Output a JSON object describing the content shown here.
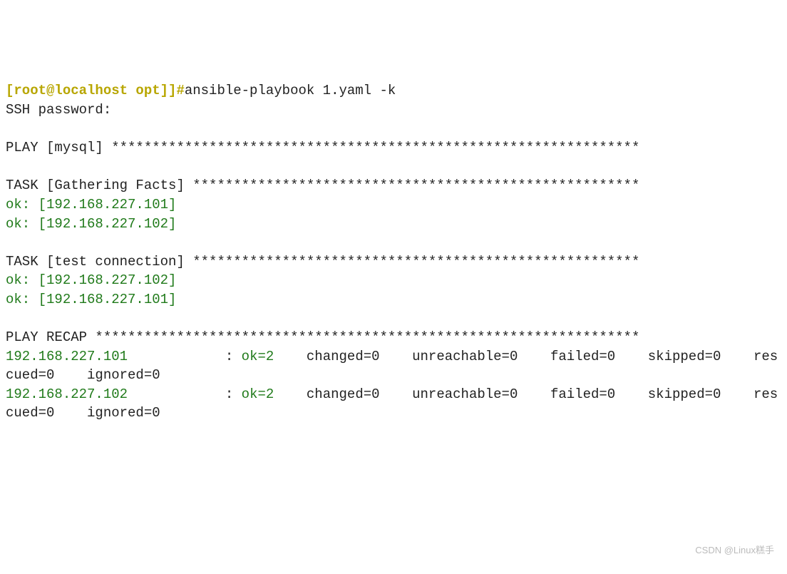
{
  "prompt": {
    "user_host": "[root@localhost opt]]#",
    "command": "ansible-playbook 1.yaml -k"
  },
  "ssh_prompt": "SSH password:",
  "play_header": "PLAY [mysql] *****************************************************************",
  "task1_header": "TASK [Gathering Facts] *******************************************************",
  "task1_results": {
    "r1": "ok: [192.168.227.101]",
    "r2": "ok: [192.168.227.102]"
  },
  "task2_header": "TASK [test connection] *******************************************************",
  "task2_results": {
    "r1": "ok: [192.168.227.102]",
    "r2": "ok: [192.168.227.101]"
  },
  "recap_header": "PLAY RECAP *******************************************************************",
  "recap": {
    "host1": "192.168.227.101",
    "host1_sep": "            : ",
    "host1_ok": "ok=2   ",
    "host1_rest": " changed=0    unreachable=0    failed=0    skipped=0    rescued=0    ignored=0   ",
    "host2": "192.168.227.102",
    "host2_sep": "            : ",
    "host2_ok": "ok=2   ",
    "host2_rest": " changed=0    unreachable=0    failed=0    skipped=0    rescued=0    ignored=0   "
  },
  "watermark": "CSDN @Linux糕手"
}
